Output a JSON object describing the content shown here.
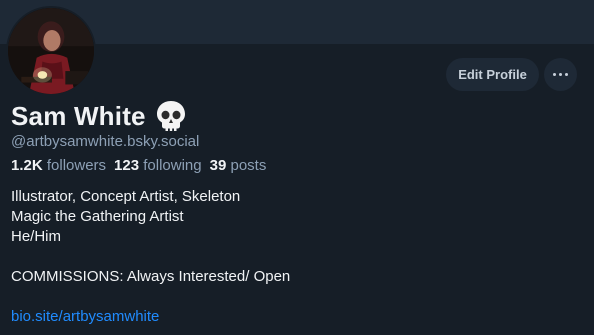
{
  "profile": {
    "display_name": "Sam White",
    "handle": "@artbysamwhite.bsky.social",
    "followers_count": "1.2K",
    "followers_label": "followers",
    "following_count": "123",
    "following_label": "following",
    "posts_count": "39",
    "posts_label": "posts",
    "bio_lines": [
      "Illustrator, Concept Artist, Skeleton",
      "Magic the Gathering Artist",
      "He/Him",
      "",
      "COMMISSIONS: Always Interested/ Open",
      ""
    ],
    "bio_link": "bio.site/artbysamwhite"
  },
  "actions": {
    "edit_profile_label": "Edit Profile"
  },
  "icons": {
    "name_emoji": "skull-icon",
    "more": "more-options-icon"
  },
  "colors": {
    "background": "#161e27",
    "banner": "#1e2936",
    "text_primary": "#f1f3f5",
    "text_secondary": "#8da0b5",
    "link": "#208bfe",
    "button_bg": "#1e2936"
  }
}
